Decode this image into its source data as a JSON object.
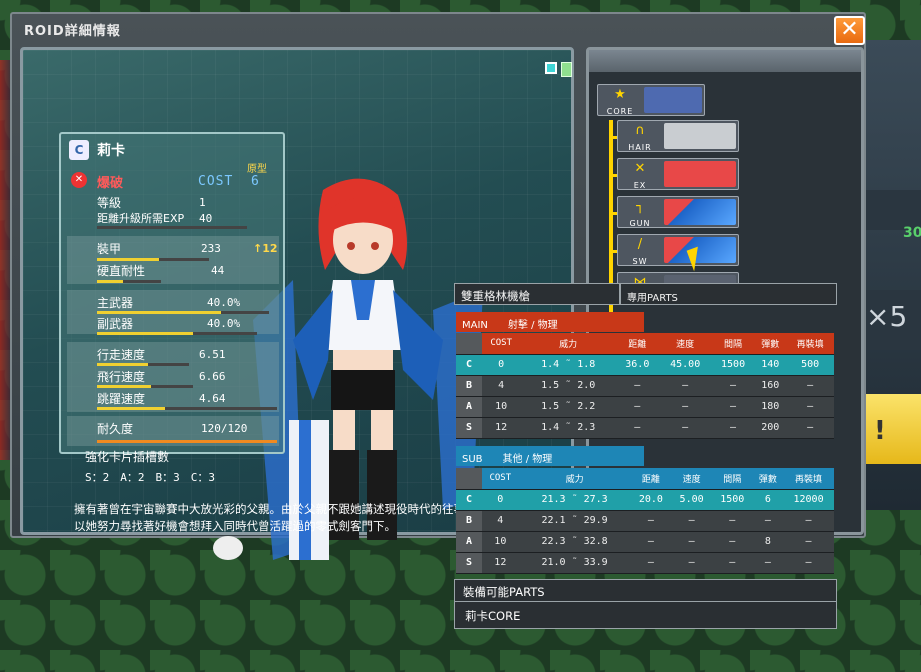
{
  "window": {
    "title": "ROID詳細情報",
    "close": "✕"
  },
  "background": {
    "x5": "×5",
    "num": "30",
    "exclaim": "!"
  },
  "character": {
    "rank": "C",
    "name": "莉卡",
    "proto": "原型",
    "type": "爆破",
    "cost_label": "COST",
    "cost_value": "6",
    "level_label": "等級",
    "level_value": "1",
    "exp_label": "距離升級所需EXP",
    "exp_value": "40",
    "armor_label": "裝甲",
    "armor_value": "233",
    "armor_up": "↑12",
    "stiff_label": "硬直耐性",
    "stiff_value": "44",
    "main_label": "主武器",
    "main_value": "40.0%",
    "sub_label": "副武器",
    "sub_value": "40.0%",
    "walk_label": "行走速度",
    "walk_value": "6.51",
    "fly_label": "飛行速度",
    "fly_value": "6.66",
    "jump_label": "跳躍速度",
    "jump_value": "4.64",
    "dur_label": "耐久度",
    "dur_value": "120/120",
    "slots_title": "強化卡片插槽數",
    "slots": "S：2　A：2　B：3　C：3",
    "description": "擁有著曾在宇宙聯賽中大放光彩的父親。由於父親不跟她講述現役時代的往事，所以她努力尋找著好機會想拜入同時代曾活躍過的零式劍客門下。"
  },
  "stat_levels": {
    "armor": 0.55,
    "stiff": 0.4,
    "main": 0.72,
    "sub": 0.6,
    "walk": 0.55,
    "fly": 0.56,
    "jump": 0.38,
    "dur": 1.0,
    "exp": 0.0
  },
  "parts": {
    "core": "CORE",
    "hair": "HAIR",
    "ex": "EX",
    "gun": "GUN",
    "sw": "SW"
  },
  "weapon": {
    "name": "雙重格林機槍",
    "tag": "專用PARTS",
    "main_section": "MAIN　　射擊 / 物理",
    "sub_section": "SUB　　其他 / 物理",
    "headers": [
      "",
      "COST",
      "威力",
      "距離",
      "速度",
      "間隔",
      "彈數",
      "再裝填"
    ],
    "main_rows": [
      [
        "C",
        "0",
        "1.4 ˜ 1.8",
        "36.0",
        "45.00",
        "1500",
        "140",
        "500"
      ],
      [
        "B",
        "4",
        "1.5 ˜ 2.0",
        "–",
        "–",
        "–",
        "160",
        "–"
      ],
      [
        "A",
        "10",
        "1.5 ˜ 2.2",
        "–",
        "–",
        "–",
        "180",
        "–"
      ],
      [
        "S",
        "12",
        "1.4 ˜ 2.3",
        "–",
        "–",
        "–",
        "200",
        "–"
      ]
    ],
    "sub_rows": [
      [
        "C",
        "0",
        "21.3 ˜ 27.3",
        "20.0",
        "5.00",
        "1500",
        "6",
        "12000"
      ],
      [
        "B",
        "4",
        "22.1 ˜ 29.9",
        "–",
        "–",
        "–",
        "–",
        "–"
      ],
      [
        "A",
        "10",
        "22.3 ˜ 32.8",
        "–",
        "–",
        "–",
        "8",
        "–"
      ],
      [
        "S",
        "12",
        "21.0 ˜ 33.9",
        "–",
        "–",
        "–",
        "–",
        "–"
      ]
    ]
  },
  "equip": {
    "title": "裝備可能PARTS",
    "item": "莉卡CORE"
  }
}
